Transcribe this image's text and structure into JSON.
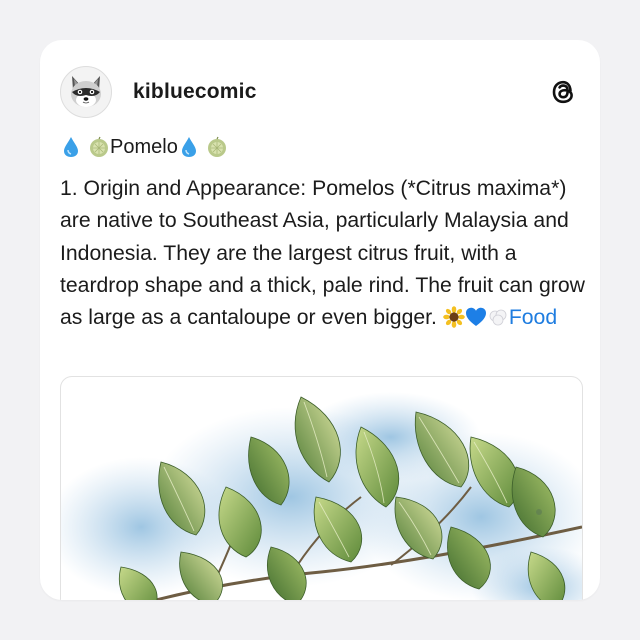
{
  "post": {
    "username": "kibluecomic",
    "avatar_icon": "raccoon-icon",
    "platform_icon": "threads-logo-icon",
    "title_line": {
      "leading_icons": [
        "droplet-icon",
        "pomelo-icon"
      ],
      "title": "Pomelo",
      "trailing_icons": [
        "droplet-icon",
        "pomelo-icon"
      ]
    },
    "body": "1. Origin and Appearance: Pomelos (*Citrus maxima*) are native to Southeast Asia, particularly Malaysia and Indonesia. They are the largest citrus fruit, with a teardrop shape and a thick, pale rind. The fruit can grow as large as a cantaloupe or even bigger.",
    "body_trailing_icons": [
      "sunflower-icon",
      "blue-heart-icon",
      "cotton-icon"
    ],
    "hashtag": "Food",
    "image_icon": "watercolor-leaves-image"
  },
  "colors": {
    "background": "#f2f2f4",
    "card": "#ffffff",
    "text": "#1b1b1b",
    "link": "#1f7de0"
  }
}
